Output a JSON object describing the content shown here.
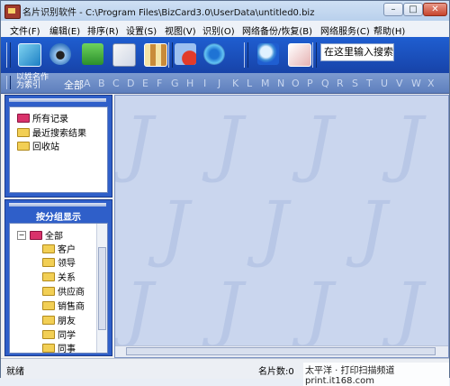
{
  "title": "名片识别软件 - C:\\Program Files\\BizCard3.0\\UserData\\untitled0.biz",
  "window_buttons": {
    "minimize": "–",
    "maximize": "□",
    "close": "✕"
  },
  "menu": [
    "文件(F)",
    "编辑(E)",
    "排序(R)",
    "设置(S)",
    "视图(V)",
    "识别(O)",
    "网络备份/恢复(B)",
    "网络服务(C)",
    "帮助(H)"
  ],
  "toolbar": {
    "icons": [
      "scan-card-icon",
      "camera-icon",
      "import-export-icon",
      "mail-icon",
      "select-all-icon",
      "delete-card-icon",
      "sync-icon",
      "search-icon",
      "edit-card-icon"
    ],
    "search_placeholder": "在这里输入搜索"
  },
  "alphabar": {
    "label_line1": "以姓名作",
    "label_line2": "为索引",
    "all": "全部",
    "letters": [
      "A",
      "B",
      "C",
      "D",
      "E",
      "F",
      "G",
      "H",
      "I",
      "J",
      "K",
      "L",
      "M",
      "N",
      "O",
      "P",
      "Q",
      "R",
      "S",
      "T",
      "U",
      "V",
      "W",
      "X"
    ]
  },
  "records_tree": [
    "所有记录",
    "最近搜索结果",
    "回收站"
  ],
  "group_panel": {
    "title": "按分组显示",
    "root": "全部",
    "expander": "−",
    "groups": [
      "客户",
      "领导",
      "关系",
      "供应商",
      "销售商",
      "朋友",
      "同学",
      "同事"
    ]
  },
  "content_watermark": "J",
  "status": {
    "left": "就绪",
    "right": "名片数:0"
  },
  "site_watermark": "太平洋 · 打印扫描频道  print.it168.com",
  "colors": {
    "toolbar": "#1f5ed1",
    "panel": "#2f5fc9",
    "content": "#cad6ee"
  }
}
